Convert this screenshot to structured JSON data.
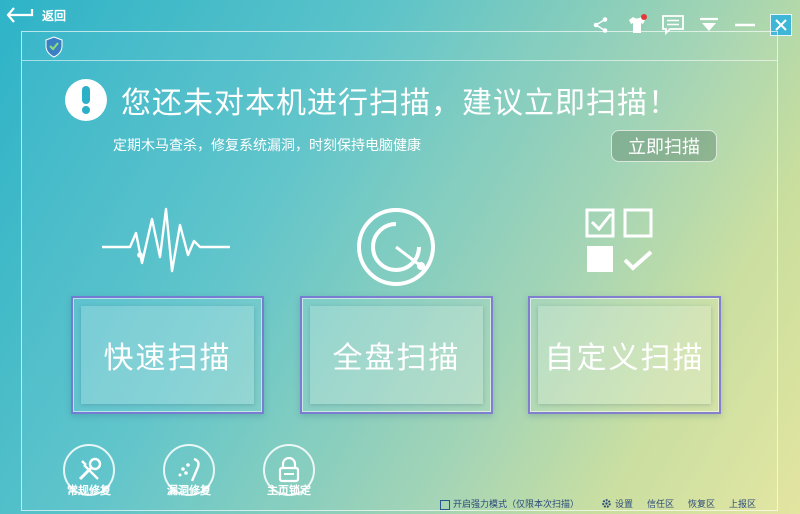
{
  "topbar": {
    "back_label": "返回"
  },
  "notice": {
    "headline": "您还未对本机进行扫描，建议立即扫描！",
    "subline": "定期木马查杀，修复系统漏洞，时刻保持电脑健康",
    "scan_now_label": "立即扫描"
  },
  "scan_modes": [
    {
      "label": "快速扫描",
      "icon": "pulse-wave-icon"
    },
    {
      "label": "全盘扫描",
      "icon": "radar-dial-icon"
    },
    {
      "label": "自定义扫描",
      "icon": "checklist-icon"
    }
  ],
  "tools": [
    {
      "label": "常规修复",
      "icon": "wrench-screwdriver-icon"
    },
    {
      "label": "漏洞修复",
      "icon": "bug-wrench-icon"
    },
    {
      "label": "主页锁定",
      "icon": "padlock-icon"
    }
  ],
  "footer": {
    "boost_label": "开启强力模式（仅限本次扫描）",
    "settings_label": "设置",
    "trust_label": "信任区",
    "restore_label": "恢复区",
    "report_label": "上报区"
  }
}
